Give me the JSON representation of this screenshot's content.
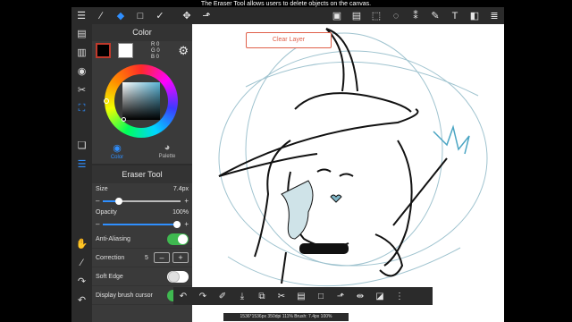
{
  "caption": "The Eraser Tool allows users to delete objects on the canvas.",
  "toolbar": {
    "left_icons": [
      "menu-icon",
      "brush-icon",
      "eraser-icon",
      "rect-select-icon",
      "magic-wand-icon",
      "move-icon",
      "transform-icon"
    ],
    "left_glyphs": [
      "☰",
      "∕",
      "◆",
      "□",
      "✓",
      "✥",
      "⬏"
    ],
    "right_icons": [
      "fill-icon",
      "gradient-icon",
      "shape-select-icon",
      "lasso-icon",
      "wand-select-icon",
      "pen-select-icon",
      "text-icon",
      "frame-icon",
      "layers-icon"
    ],
    "right_glyphs": [
      "▣",
      "▤",
      "⬚",
      "◌",
      "⁑",
      "✎",
      "T",
      "◧",
      "≣"
    ]
  },
  "rail": {
    "icons": [
      "pages-icon",
      "brush-list-icon",
      "navigator-icon",
      "ruler-icon",
      "fill-bucket-icon",
      "layer-icon",
      "layer-list-icon",
      "hand-icon",
      "eyedropper-icon",
      "redo-icon",
      "undo-icon"
    ],
    "glyphs": [
      "▤",
      "▥",
      "◉",
      "✂",
      "⛶",
      "❏",
      "☰",
      "✋",
      "⁄",
      "↷",
      "↶"
    ]
  },
  "color_panel": {
    "title": "Color",
    "rgb": {
      "r": "R 0",
      "g": "G 0",
      "b": "B 0"
    },
    "tabs": [
      {
        "label": "Color",
        "icon": "color-wheel-icon",
        "glyph": "◉"
      },
      {
        "label": "Palette",
        "icon": "palette-icon",
        "glyph": "◕"
      }
    ]
  },
  "brush_panel": {
    "title": "Eraser Tool",
    "size": {
      "label": "Size",
      "value": "7.4px",
      "fraction": 0.2
    },
    "opacity": {
      "label": "Opacity",
      "value": "100%",
      "fraction": 0.95
    },
    "anti_aliasing": {
      "label": "Anti-Aliasing",
      "on": true
    },
    "correction": {
      "label": "Correction",
      "value": "5"
    },
    "soft_edge": {
      "label": "Soft Edge",
      "on": false
    },
    "display_cursor": {
      "label": "Display brush cursor",
      "on": true
    }
  },
  "canvas": {
    "clear_layer_label": "Clear Layer"
  },
  "bottom_bar": {
    "icons": [
      "undo-icon",
      "redo-icon",
      "eyedropper-icon",
      "save-icon",
      "copy-icon",
      "cut-icon",
      "paste-icon",
      "select-all-icon",
      "deselect-icon",
      "flip-icon",
      "mask-icon",
      "more-icon"
    ],
    "glyphs": [
      "↶",
      "↷",
      "✐",
      "⤓",
      "⧉",
      "✂",
      "▤",
      "□",
      "⬏",
      "⇹",
      "◪",
      "⋮"
    ]
  },
  "status": "1536*1536px 350dpi 111% Brush: 7.4px 100%"
}
